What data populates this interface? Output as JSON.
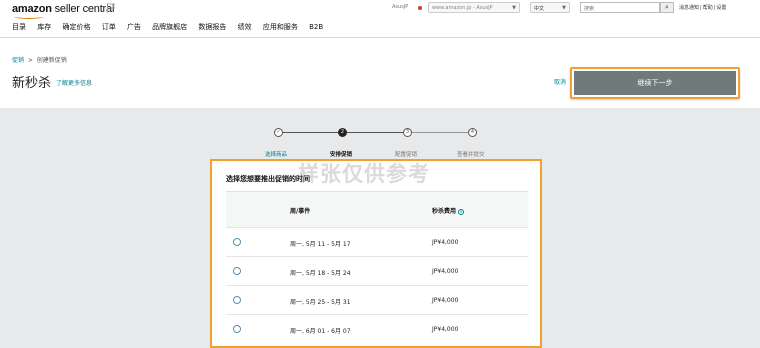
{
  "header": {
    "logo_brand": "amazon",
    "logo_product": "seller central",
    "account": "AsusJP",
    "store": "www.amazon.jp - AsusJP",
    "language": "中文",
    "search_placeholder": "搜索",
    "links": [
      "消息通知",
      "帮助",
      "设置"
    ],
    "nav": [
      "目录",
      "库存",
      "确定价格",
      "订单",
      "广告",
      "品牌旗舰店",
      "数据报告",
      "绩效",
      "应用和服务",
      "B2B"
    ]
  },
  "page": {
    "breadcrumb_root": "促销",
    "breadcrumb_sep": ">",
    "breadcrumb_current": "创建新促销",
    "title": "新秒杀",
    "learn_more": "了解更多信息",
    "cancel": "取消",
    "continue_button": "继续下一步"
  },
  "steps": [
    {
      "num": "✓",
      "label": "选择商品"
    },
    {
      "num": "2",
      "label": "安排促销"
    },
    {
      "num": "3",
      "label": "配置促销"
    },
    {
      "num": "4",
      "label": "查看并提交"
    }
  ],
  "watermark": "样张仅供参考",
  "selection": {
    "title": "选择您想要推出促销的时间",
    "col_week": "周/事件",
    "col_fee": "秒杀费用",
    "rows": [
      {
        "week": "周一, 5月 11 - 5月 17",
        "fee": "JP¥4,000"
      },
      {
        "week": "周一, 5月 18 - 5月 24",
        "fee": "JP¥4,000"
      },
      {
        "week": "周一, 5月 25 - 5月 31",
        "fee": "JP¥4,000"
      },
      {
        "week": "周一, 6月 01 - 6月 07",
        "fee": "JP¥4,000"
      }
    ]
  },
  "colors": {
    "highlight": "#f0a030",
    "button": "#707a7a",
    "link": "#008296"
  }
}
